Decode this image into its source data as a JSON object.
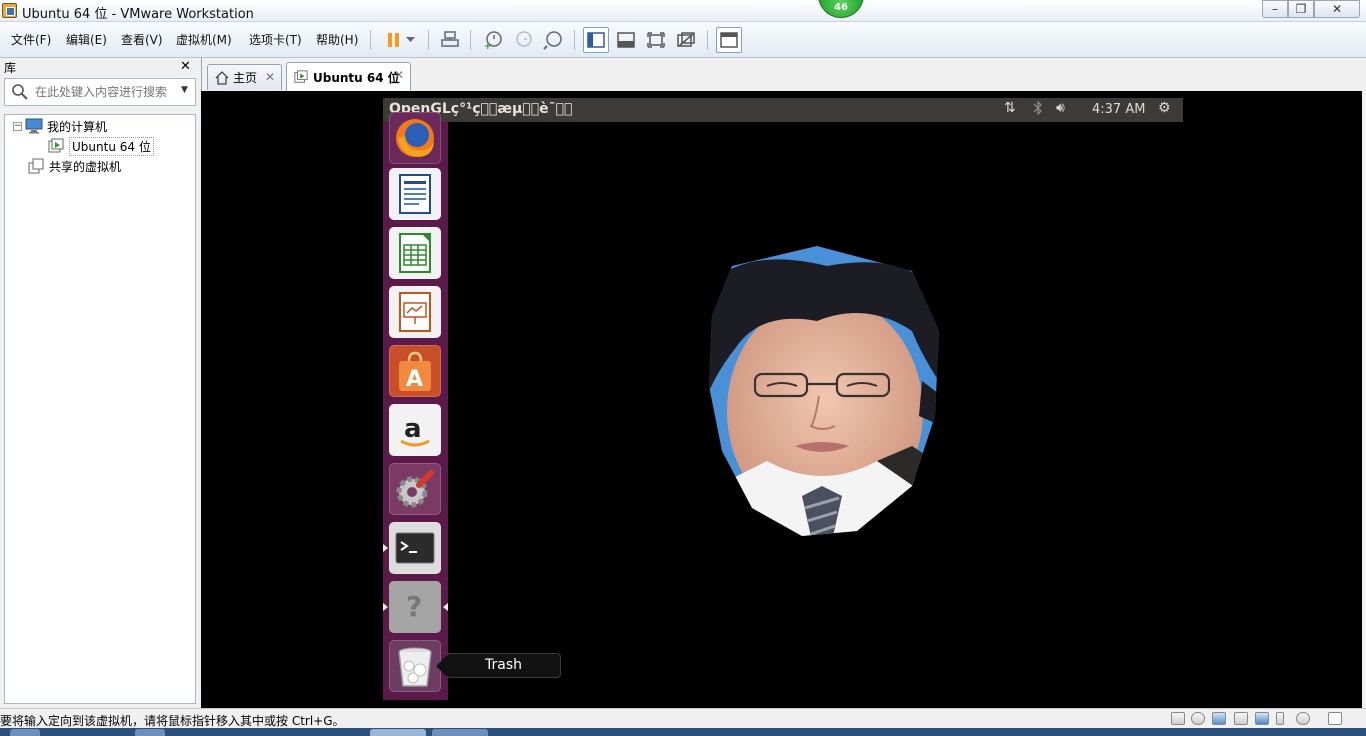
{
  "window": {
    "title": "Ubuntu 64 位 - VMware Workstation",
    "badge": "46",
    "min": "–",
    "max": "❐",
    "close": "✕"
  },
  "menu": [
    "文件(F)",
    "编辑(E)",
    "查看(V)",
    "虚拟机(M)",
    "选项卡(T)",
    "帮助(H)"
  ],
  "library": {
    "title": "库",
    "close": "✕",
    "search_placeholder": "在此处键入内容进行搜索",
    "tree": {
      "expander": "−",
      "my_computer": "我的计算机",
      "vm": "Ubuntu 64 位",
      "shared": "共享的虚拟机"
    }
  },
  "tabs": [
    {
      "label": "主页",
      "close": "✕"
    },
    {
      "label": "Ubuntu 64 位",
      "close": "✕"
    }
  ],
  "guest": {
    "panel_title": "OpenGLç°¹ç\u0000\u0000æµ\u0000\u0000è¯\u0000\u0000",
    "clock": "4:37 AM",
    "launcher": [
      "firefox-icon",
      "writer-icon",
      "calc-icon",
      "impress-icon",
      "software-center-icon",
      "amazon-icon",
      "system-settings-icon",
      "terminal-icon",
      "help-icon",
      "trash-icon"
    ],
    "help_glyph": "?",
    "tooltip": "Trash"
  },
  "status": {
    "text": "要将输入定向到该虚拟机，请将鼠标指针移入其中或按 Ctrl+G。"
  }
}
